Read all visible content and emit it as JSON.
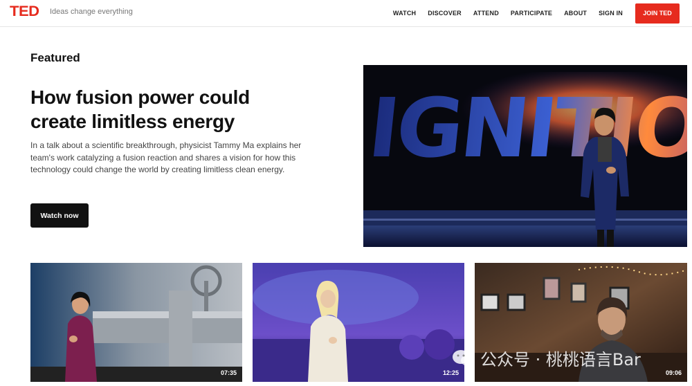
{
  "header": {
    "logo": "TED",
    "tagline": "Ideas change everything",
    "nav": [
      "WATCH",
      "DISCOVER",
      "ATTEND",
      "PARTICIPATE",
      "ABOUT",
      "SIGN IN"
    ],
    "join_label": "JOIN TED"
  },
  "featured": {
    "label": "Featured",
    "title_line1": "How fusion power could",
    "title_line2": "create limitless energy",
    "description": "In a talk about a scientific breakthrough, physicist Tammy Ma explains her team's work catalyzing a fusion reaction and shares a vision for how this technology could change the world by creating limitless clean energy.",
    "cta": "Watch now",
    "stage_text": "IGNITION"
  },
  "thumbnails": [
    {
      "duration": "07:35"
    },
    {
      "duration": "12:25"
    },
    {
      "duration": "09:06"
    }
  ],
  "watermark": "公众号 · 桃桃语言Bar",
  "colors": {
    "brand": "#e62b1e",
    "button_dark": "#111111"
  }
}
